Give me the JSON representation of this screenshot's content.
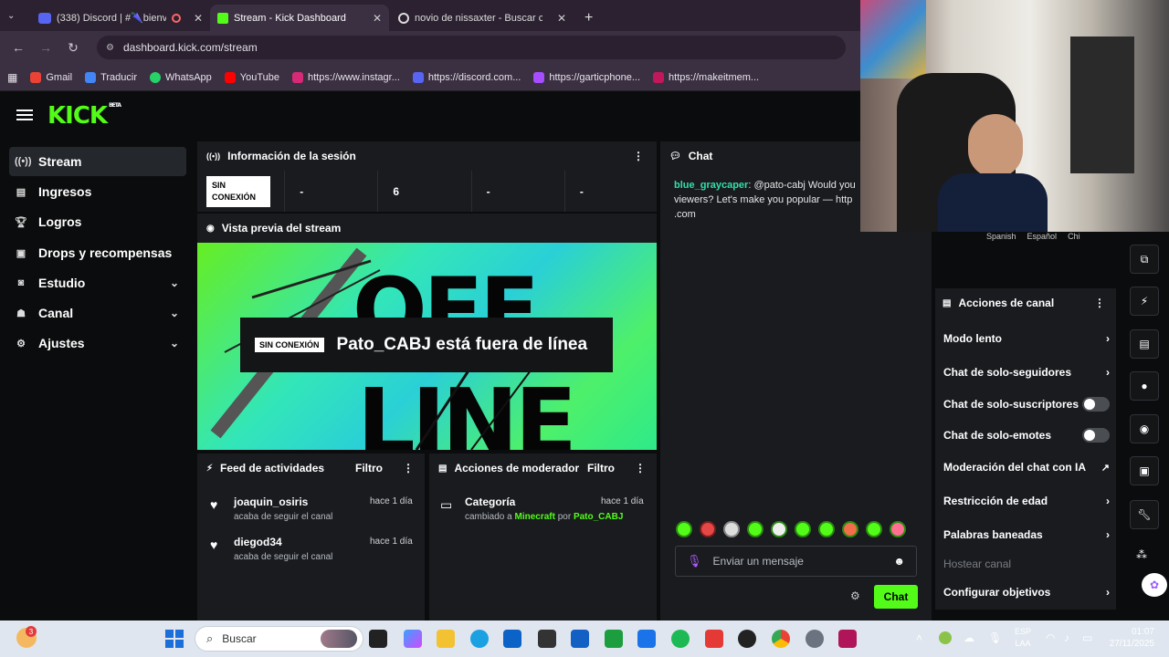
{
  "browser": {
    "tabs": [
      {
        "label": "(338) Discord | #🌂bienven"
      },
      {
        "label": "Stream - Kick Dashboard"
      },
      {
        "label": "novio de nissaxter - Buscar con"
      }
    ],
    "url": "dashboard.kick.com/stream",
    "bookmarks": [
      {
        "label": "Gmail",
        "color": "#ea4335"
      },
      {
        "label": "Traducir",
        "color": "#4285f4"
      },
      {
        "label": "WhatsApp",
        "color": "#25d366"
      },
      {
        "label": "YouTube",
        "color": "#ff0000"
      },
      {
        "label": "https://www.instagr...",
        "color": "#d62976"
      },
      {
        "label": "https://discord.com...",
        "color": "#5865f2"
      },
      {
        "label": "https://garticphone...",
        "color": "#a64dff"
      },
      {
        "label": "https://makeitmem...",
        "color": "#c2185b"
      }
    ]
  },
  "kick": {
    "logo": "KICK",
    "logo_badge": "BETA",
    "sidebar": [
      {
        "label": "Stream",
        "icon": "broadcast-icon"
      },
      {
        "label": "Ingresos",
        "icon": "chart-icon"
      },
      {
        "label": "Logros",
        "icon": "trophy-icon"
      },
      {
        "label": "Drops y recompensas",
        "icon": "gift-icon"
      },
      {
        "label": "Estudio",
        "icon": "studio-icon"
      },
      {
        "label": "Canal",
        "icon": "user-icon"
      },
      {
        "label": "Ajustes",
        "icon": "gear-icon"
      }
    ],
    "session": {
      "title": "Información de la sesión",
      "status": "SIN CONEXIÓN",
      "stats": [
        "-",
        "6",
        "-",
        "-"
      ]
    },
    "preview": {
      "title": "Vista previa del stream",
      "badge": "SIN CONEXIÓN",
      "message": "Pato_CABJ está fuera de línea"
    },
    "feed": {
      "title": "Feed de actividades",
      "filter": "Filtro",
      "items": [
        {
          "user": "joaquin_osiris",
          "action": "acaba de seguir el canal",
          "time": "hace 1 día"
        },
        {
          "user": "diegod34",
          "action": "acaba de seguir el canal",
          "time": "hace 1 día"
        }
      ]
    },
    "mod": {
      "title": "Acciones de moderador",
      "filter": "Filtro",
      "item": {
        "label": "Categoría",
        "prefix": "cambiado a",
        "category": "Minecraft",
        "by": "por",
        "user": "Pato_CABJ",
        "time": "hace 1 día"
      }
    },
    "chat": {
      "title": "Chat",
      "message_user": "blue_graycaper",
      "message_text": ": @pato-cabj Would you viewers? Let's make you popular — http .com",
      "placeholder": "Enviar un mensaje",
      "send": "Chat"
    },
    "chips": [
      "Spanish",
      "Español",
      "Chi"
    ],
    "actions": {
      "title": "Acciones de canal",
      "items": [
        {
          "label": "Modo lento",
          "kind": "arrow"
        },
        {
          "label": "Chat de solo-seguidores",
          "kind": "arrow"
        },
        {
          "label": "Chat de solo-suscriptores",
          "kind": "toggle",
          "on": false
        },
        {
          "label": "Chat de solo-emotes",
          "kind": "toggle",
          "on": false
        },
        {
          "label": "Moderación del chat con IA",
          "kind": "external"
        },
        {
          "label": "Restricción de edad",
          "kind": "arrow"
        },
        {
          "label": "Palabras baneadas",
          "kind": "arrow"
        },
        {
          "label": "Hostear canal",
          "kind": "disabled"
        },
        {
          "label": "Configurar objetivos",
          "kind": "arrow"
        }
      ]
    }
  },
  "taskbar": {
    "search": "Buscar",
    "lang_top": "ESP",
    "lang_bottom": "LAA",
    "time": "01:07",
    "date": "27/11/2025",
    "notification_count": "3"
  },
  "colors": {
    "accent": "#53fc18",
    "panel": "#191b1f",
    "bg": "#0b0c0d"
  }
}
